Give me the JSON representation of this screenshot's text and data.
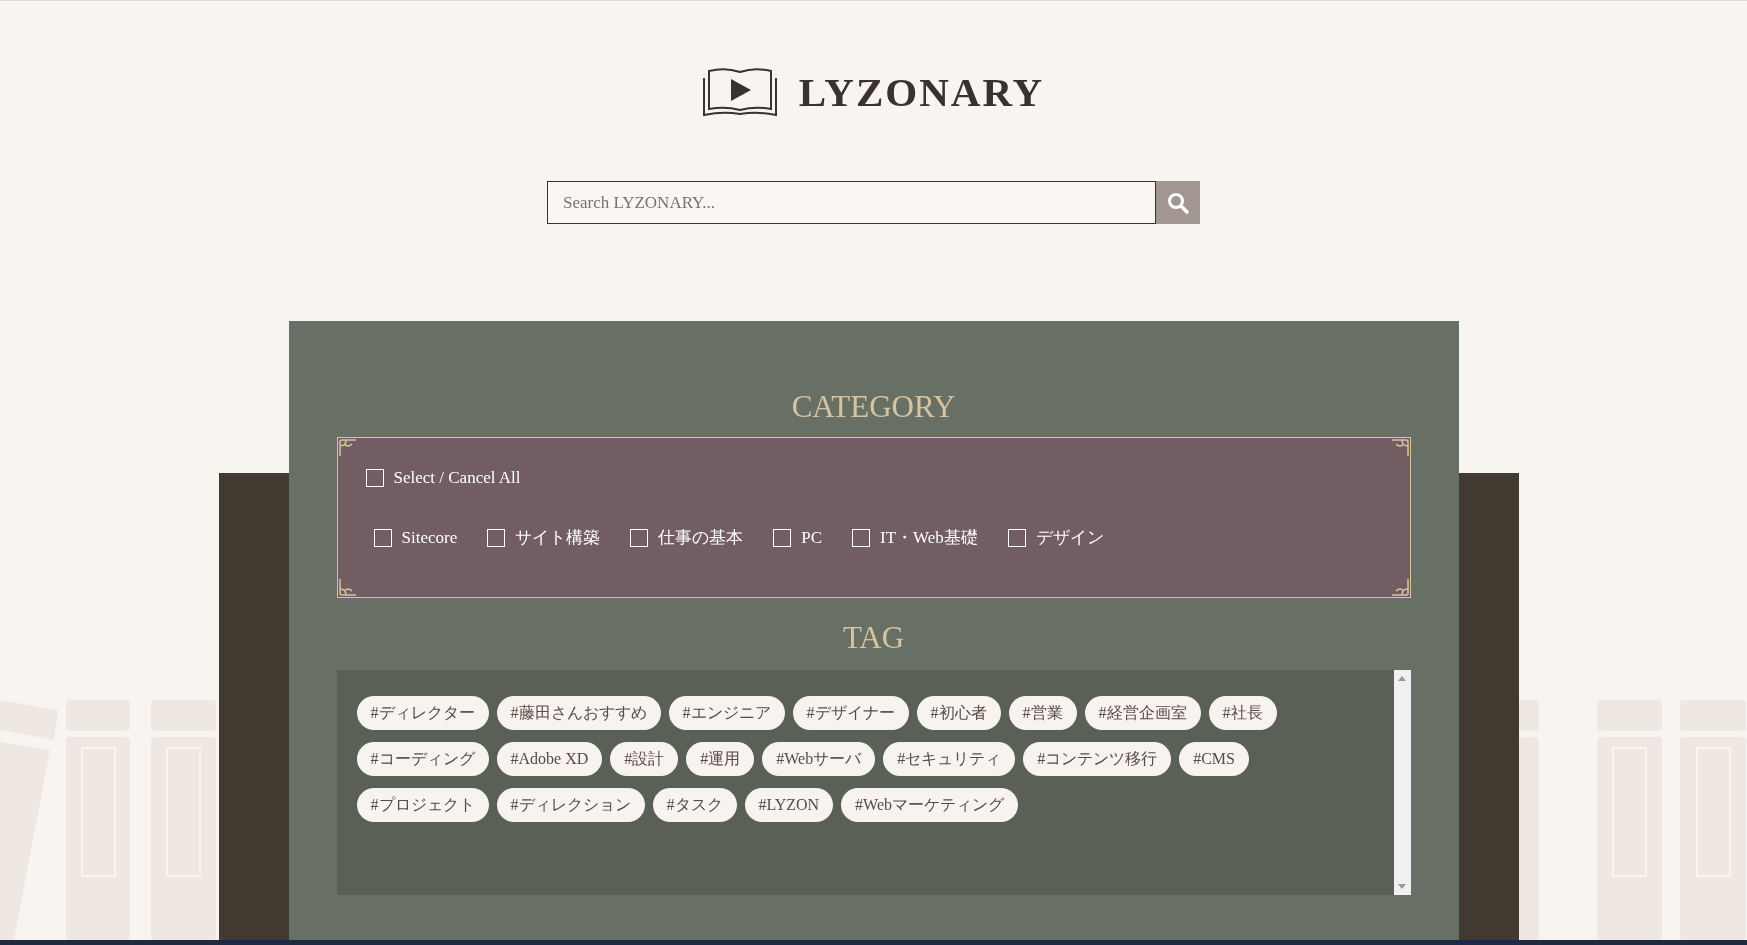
{
  "logo": {
    "text": "LYZONARY"
  },
  "search": {
    "placeholder": "Search LYZONARY..."
  },
  "category": {
    "title": "CATEGORY",
    "select_all": {
      "label": "Select / Cancel All",
      "checked": false
    },
    "items": [
      {
        "label": "Sitecore",
        "checked": false
      },
      {
        "label": "サイト構築",
        "checked": false
      },
      {
        "label": "仕事の基本",
        "checked": false
      },
      {
        "label": "PC",
        "checked": false
      },
      {
        "label": "IT・Web基礎",
        "checked": false
      },
      {
        "label": "デザイン",
        "checked": false
      }
    ]
  },
  "tag": {
    "title": "TAG",
    "tags": [
      "#ディレクター",
      "#藤田さんおすすめ",
      "#エンジニア",
      "#デザイナー",
      "#初心者",
      "#営業",
      "#経営企画室",
      "#社長",
      "#コーディング",
      "#Adobe XD",
      "#設計",
      "#運用",
      "#Webサーバ",
      "#セキュリティ",
      "#コンテンツ移行",
      "#CMS",
      "#プロジェクト",
      "#ディレクション",
      "#タスク",
      "#LYZON",
      "#Webマーケティング"
    ]
  }
}
